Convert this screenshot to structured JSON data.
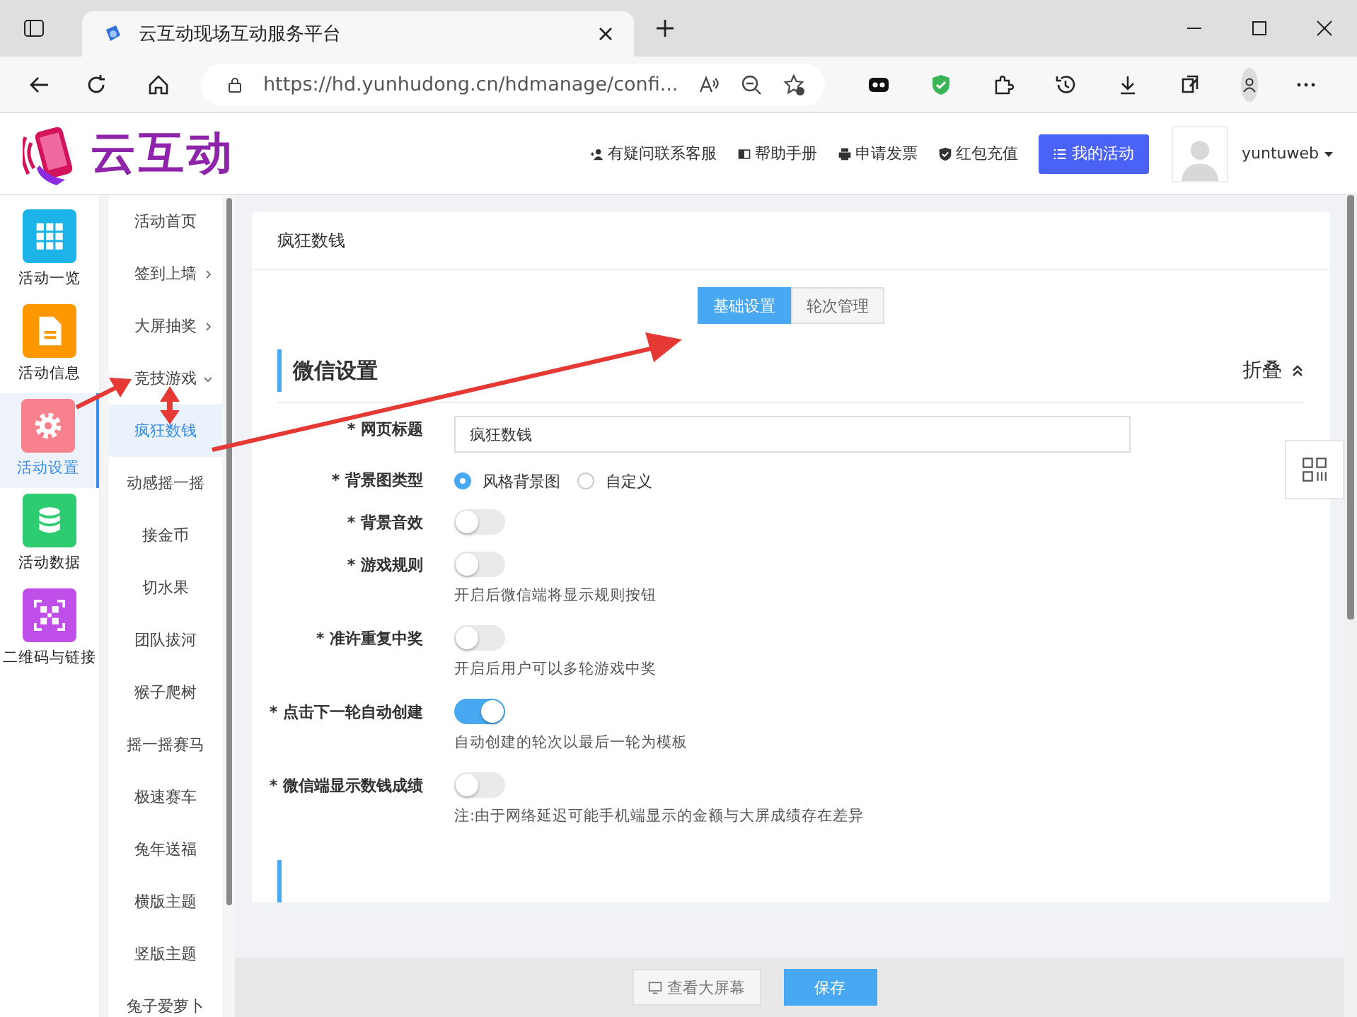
{
  "browser": {
    "tab_title": "云互动现场互动服务平台",
    "url": "https://hd.yunhudong.cn/hdmanage/confi..."
  },
  "header": {
    "logo_text": "云互动",
    "links": [
      {
        "label": "有疑问联系客服",
        "kind": "person"
      },
      {
        "label": "帮助手册",
        "kind": "book"
      },
      {
        "label": "申请发票",
        "kind": "printer"
      },
      {
        "label": "红包充值",
        "kind": "shield"
      }
    ],
    "primary_button": "我的活动",
    "username": "yuntuweb"
  },
  "sidebar": {
    "items": [
      {
        "label": "活动一览",
        "kind": "grid",
        "color": "#1cb3e8",
        "selected": false
      },
      {
        "label": "活动信息",
        "kind": "doc",
        "color": "#ff9800",
        "selected": false
      },
      {
        "label": "活动设置",
        "kind": "gear",
        "color": "#f7818c",
        "selected": true
      },
      {
        "label": "活动数据",
        "kind": "db",
        "color": "#2ecc71",
        "selected": false
      },
      {
        "label": "二维码与链接",
        "kind": "qr",
        "color": "#c04ee8",
        "selected": false
      }
    ]
  },
  "submenu": {
    "items": [
      {
        "label": "活动首页",
        "selected": false
      },
      {
        "label": "签到上墙",
        "selected": false,
        "expanded": false
      },
      {
        "label": "大屏抽奖",
        "selected": false,
        "expanded": false
      },
      {
        "label": "竞技游戏",
        "selected": false,
        "expanded": true,
        "children": [
          {
            "label": "疯狂数钱",
            "selected": true
          },
          {
            "label": "动感摇一摇",
            "selected": false
          },
          {
            "label": "接金币",
            "selected": false
          },
          {
            "label": "切水果",
            "selected": false
          },
          {
            "label": "团队拔河",
            "selected": false
          },
          {
            "label": "猴子爬树",
            "selected": false
          },
          {
            "label": "摇一摇赛马",
            "selected": false
          },
          {
            "label": "极速赛车",
            "selected": false
          },
          {
            "label": "兔年送福",
            "selected": false
          },
          {
            "label": "横版主题",
            "selected": false
          },
          {
            "label": "竖版主题",
            "selected": false
          },
          {
            "label": "兔子爱萝卜",
            "selected": false
          }
        ]
      }
    ]
  },
  "page": {
    "title": "疯狂数钱",
    "tabs": [
      {
        "label": "基础设置",
        "selected": true
      },
      {
        "label": "轮次管理",
        "selected": false
      }
    ],
    "section": {
      "title": "微信设置",
      "collapse_label": "折叠"
    },
    "fields": [
      {
        "kind": "text",
        "label": "* 网页标题",
        "value": "疯狂数钱"
      },
      {
        "kind": "radio",
        "label": "* 背景图类型",
        "options": [
          {
            "label": "风格背景图",
            "selected": true
          },
          {
            "label": "自定义",
            "selected": false
          }
        ]
      },
      {
        "kind": "switch",
        "label": "* 背景音效",
        "on": false
      },
      {
        "kind": "switch",
        "label": "* 游戏规则",
        "on": false,
        "hint": "开启后微信端将显示规则按钮"
      },
      {
        "kind": "switch",
        "label": "* 准许重复中奖",
        "on": false,
        "hint": "开启后用户可以多轮游戏中奖"
      },
      {
        "kind": "switch",
        "label": "* 点击下一轮自动创建",
        "on": true,
        "hint": "自动创建的轮次以最后一轮为模板"
      },
      {
        "kind": "switch",
        "label": "* 微信端显示数钱成绩",
        "on": false,
        "hint": "注:由于网络延迟可能手机端显示的金额与大屏成绩存在差异"
      }
    ]
  },
  "footer": {
    "buttons": [
      {
        "label": "查看大屏幕",
        "kind": "secondary"
      },
      {
        "label": "保存",
        "kind": "primary"
      }
    ]
  }
}
